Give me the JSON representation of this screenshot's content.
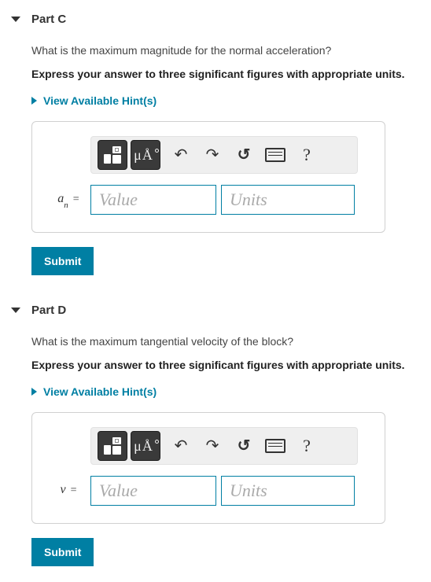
{
  "parts": [
    {
      "title": "Part C",
      "question": "What is the maximum magnitude for the normal acceleration?",
      "instruction": "Express your answer to three significant figures with appropriate units.",
      "hints_label": "View Available Hint(s)",
      "var_html": "a",
      "var_sub": "n",
      "value_placeholder": "Value",
      "units_placeholder": "Units",
      "submit_label": "Submit"
    },
    {
      "title": "Part D",
      "question": "What is the maximum tangential velocity of the block?",
      "instruction": "Express your answer to three significant figures with appropriate units.",
      "hints_label": "View Available Hint(s)",
      "var_html": "v",
      "var_sub": "",
      "value_placeholder": "Value",
      "units_placeholder": "Units",
      "submit_label": "Submit"
    }
  ],
  "toolbar": {
    "template_title": "Templates",
    "symbols_title": "Symbols μÅ",
    "undo_title": "Undo",
    "redo_title": "Redo",
    "reset_title": "Reset",
    "keyboard_title": "Keyboard",
    "help_title": "Help"
  }
}
